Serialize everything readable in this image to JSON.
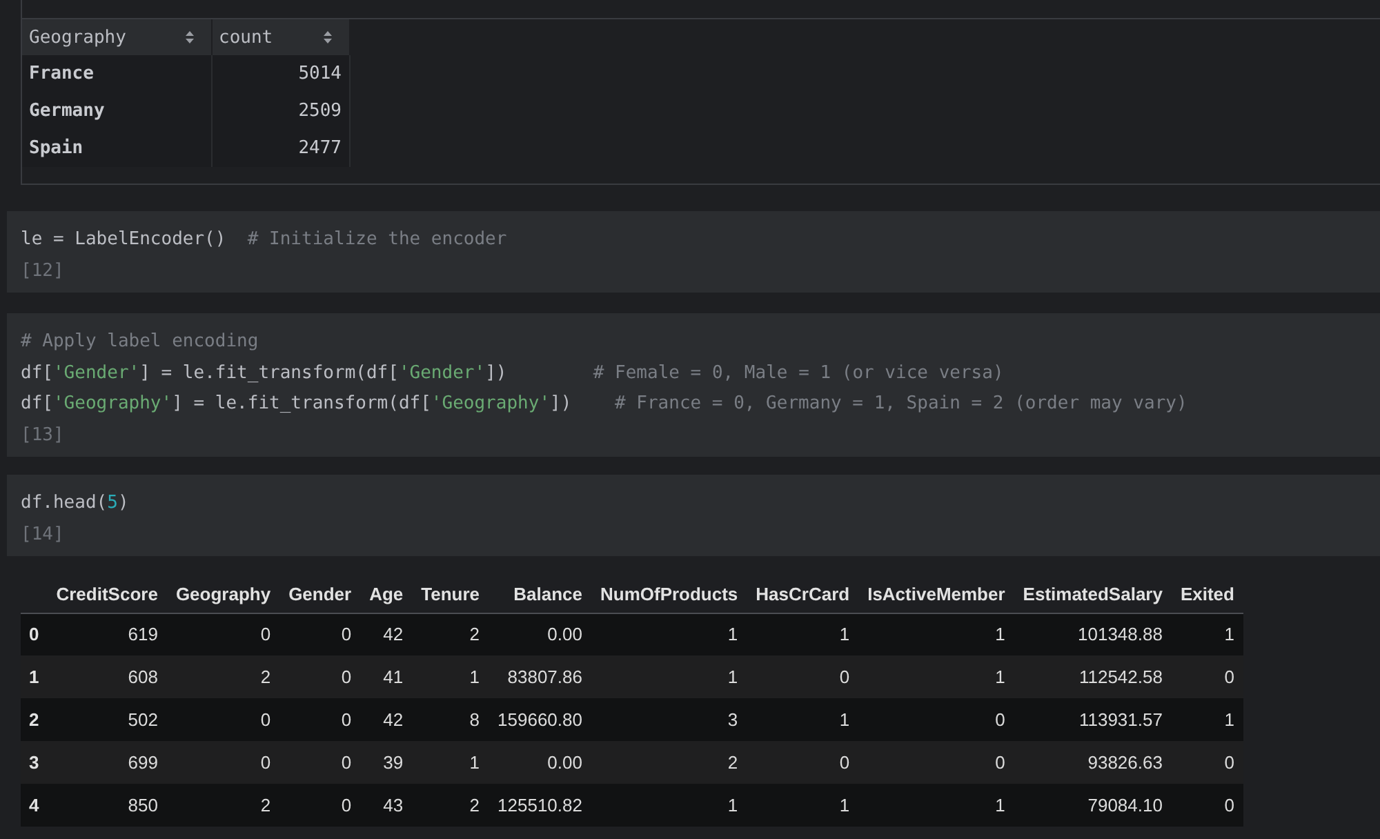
{
  "output_panel": {
    "table": {
      "columns": [
        {
          "label": "Geography"
        },
        {
          "label": "count"
        }
      ],
      "rows": [
        {
          "cells": [
            "France",
            "5014"
          ]
        },
        {
          "cells": [
            "Germany",
            "2509"
          ]
        },
        {
          "cells": [
            "Spain",
            "2477"
          ]
        }
      ]
    }
  },
  "cells": [
    {
      "lines": [
        [
          {
            "kind": "plain",
            "text": "le = LabelEncoder()  "
          },
          {
            "kind": "comment",
            "text": "# Initialize the encoder"
          }
        ]
      ],
      "execution_count": "[12]"
    },
    {
      "lines": [
        [
          {
            "kind": "comment",
            "text": "# Apply label encoding"
          }
        ],
        [
          {
            "kind": "plain",
            "text": "df["
          },
          {
            "kind": "string",
            "text": "'Gender'"
          },
          {
            "kind": "plain",
            "text": "] = le.fit_transform(df["
          },
          {
            "kind": "string",
            "text": "'Gender'"
          },
          {
            "kind": "plain",
            "text": "])        "
          },
          {
            "kind": "comment",
            "text": "# Female = 0, Male = 1 (or vice versa)"
          }
        ],
        [
          {
            "kind": "plain",
            "text": "df["
          },
          {
            "kind": "string",
            "text": "'Geography'"
          },
          {
            "kind": "plain",
            "text": "] = le.fit_transform(df["
          },
          {
            "kind": "string",
            "text": "'Geography'"
          },
          {
            "kind": "plain",
            "text": "])    "
          },
          {
            "kind": "comment",
            "text": "# France = 0, Germany = 1, Spain = 2 (order may vary)"
          }
        ]
      ],
      "execution_count": "[13]"
    },
    {
      "lines": [
        [
          {
            "kind": "plain",
            "text": "df.head("
          },
          {
            "kind": "number",
            "text": "5"
          },
          {
            "kind": "plain",
            "text": ")"
          }
        ]
      ],
      "execution_count": "[14]"
    }
  ],
  "dataframe": {
    "columns": [
      "CreditScore",
      "Geography",
      "Gender",
      "Age",
      "Tenure",
      "Balance",
      "NumOfProducts",
      "HasCrCard",
      "IsActiveMember",
      "EstimatedSalary",
      "Exited"
    ],
    "rows": [
      {
        "index": "0",
        "cells": [
          "619",
          "0",
          "0",
          "42",
          "2",
          "0.00",
          "1",
          "1",
          "1",
          "101348.88",
          "1"
        ]
      },
      {
        "index": "1",
        "cells": [
          "608",
          "2",
          "0",
          "41",
          "1",
          "83807.86",
          "1",
          "0",
          "1",
          "112542.58",
          "0"
        ]
      },
      {
        "index": "2",
        "cells": [
          "502",
          "0",
          "0",
          "42",
          "8",
          "159660.80",
          "3",
          "1",
          "0",
          "113931.57",
          "1"
        ]
      },
      {
        "index": "3",
        "cells": [
          "699",
          "0",
          "0",
          "39",
          "1",
          "0.00",
          "2",
          "0",
          "0",
          "93826.63",
          "0"
        ]
      },
      {
        "index": "4",
        "cells": [
          "850",
          "2",
          "0",
          "43",
          "2",
          "125510.82",
          "1",
          "1",
          "1",
          "79084.10",
          "0"
        ]
      }
    ]
  }
}
